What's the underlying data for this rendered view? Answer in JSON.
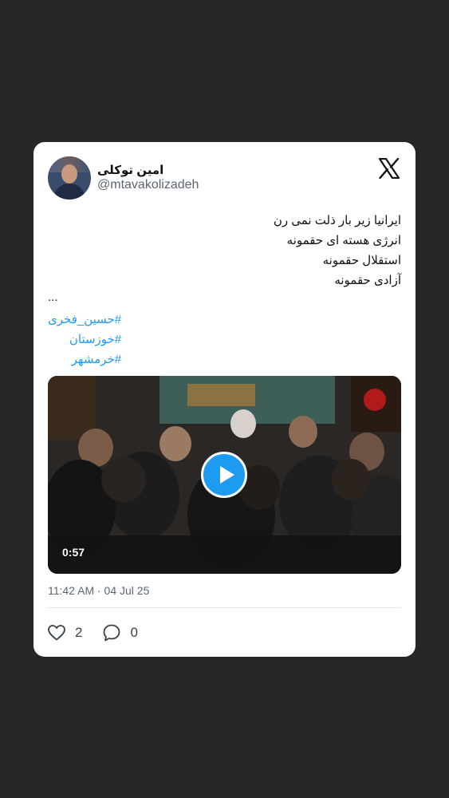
{
  "author": {
    "display_name": "امین توکلی",
    "handle": "@mtavakolizadeh"
  },
  "brand": {
    "logo_icon": "x-logo-icon"
  },
  "tweet": {
    "lines": [
      "ایرانیا زیر بار ذلت نمی رن",
      "انرژی هسته ای حقمونه",
      "استقلال حقمونه",
      "آزادی حقمونه"
    ],
    "ellipsis": "...",
    "hashtags": [
      "#حسین_فخری",
      "#خوزستان",
      "#خرمشهر"
    ]
  },
  "video": {
    "duration": "0:57",
    "play_icon": "play-icon"
  },
  "meta": {
    "timestamp": "11:42 AM · 04 Jul 25"
  },
  "actions": {
    "likes": "2",
    "replies": "0",
    "like_icon": "heart-icon",
    "reply_icon": "speech-bubble-icon"
  },
  "colors": {
    "page_background": "#272727",
    "card_background": "#ffffff",
    "link": "#1d9bf0",
    "play_button": "#1d9bf0",
    "muted_text": "#5b6670"
  }
}
